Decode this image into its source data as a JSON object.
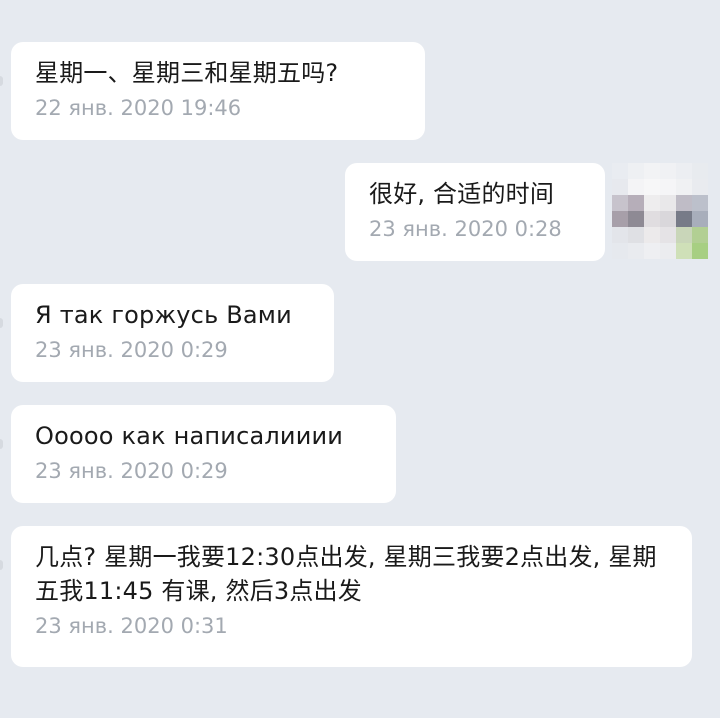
{
  "conversation": {
    "messages": [
      {
        "text": "星期一、星期三和星期五吗?",
        "time": "22 янв. 2020 19:46",
        "direction": "incoming"
      },
      {
        "text": "很好, 合适的时间",
        "time": "23 янв. 2020 0:28",
        "direction": "outgoing"
      },
      {
        "text": "Я так горжусь Вами",
        "time": "23 янв. 2020 0:29",
        "direction": "incoming"
      },
      {
        "text": "Ооооо как написалииии",
        "time": "23 янв. 2020 0:29",
        "direction": "incoming"
      },
      {
        "text": "几点? 星期一我要12:30点出发, 星期三我要2点出发, 星期五我11:45 有课, 然后3点出发",
        "time": "23 янв. 2020 0:31",
        "direction": "incoming"
      }
    ]
  },
  "colors": {
    "background": "#e6eaf0",
    "bubble": "#ffffff",
    "text": "#1a1a1a",
    "timestamp": "#a3a9b1"
  }
}
